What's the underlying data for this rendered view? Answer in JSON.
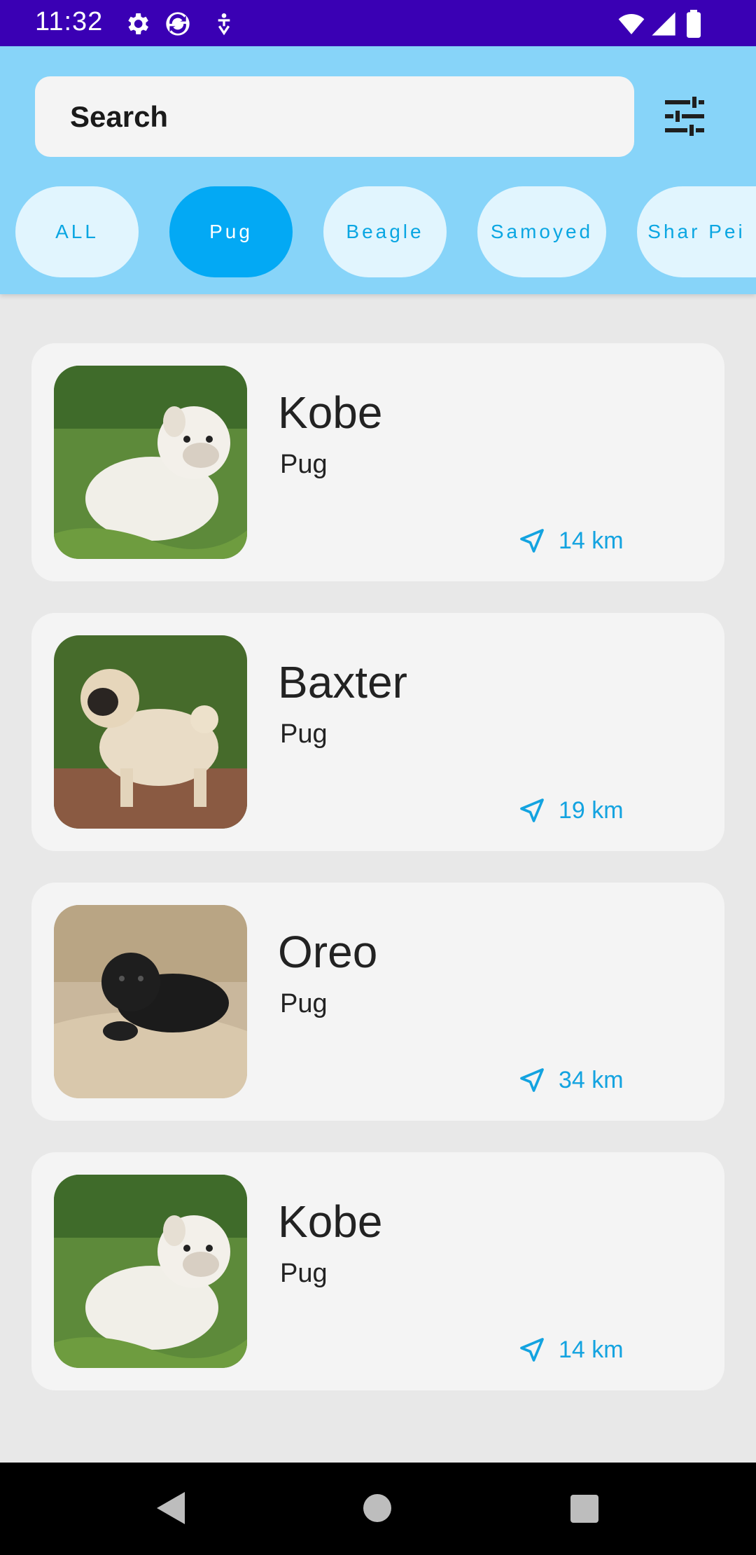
{
  "status_bar": {
    "time": "11:32"
  },
  "search": {
    "placeholder": "Search"
  },
  "chips": [
    {
      "label": "ALL",
      "active": false
    },
    {
      "label": "Pug",
      "active": true
    },
    {
      "label": "Beagle",
      "active": false
    },
    {
      "label": "Samoyed",
      "active": false
    },
    {
      "label": "Shar Pei",
      "active": false
    }
  ],
  "pets": [
    {
      "name": "Kobe",
      "breed": "Pug",
      "distance": "14 km",
      "photo": "white-pug-puppy-on-grass"
    },
    {
      "name": "Baxter",
      "breed": "Pug",
      "distance": "19 km",
      "photo": "fawn-pug-puppy-standing"
    },
    {
      "name": "Oreo",
      "breed": "Pug",
      "distance": "34 km",
      "photo": "black-pug-puppy-on-couch"
    },
    {
      "name": "Kobe",
      "breed": "Pug",
      "distance": "14 km",
      "photo": "white-pug-puppy-on-grass"
    }
  ],
  "colors": {
    "header": "#87d4f9",
    "accent": "#03a9f4",
    "status_bar": "#3a00b4"
  }
}
